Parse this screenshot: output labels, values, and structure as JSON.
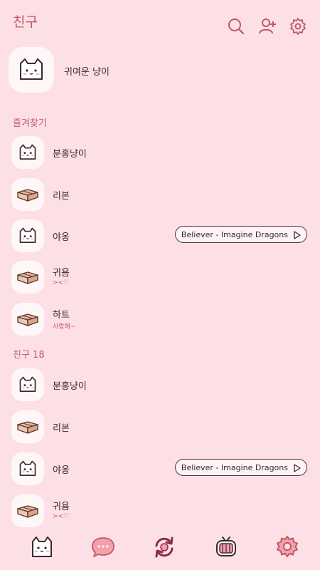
{
  "header": {
    "title": "친구"
  },
  "profile": {
    "name": "귀여운 냥이"
  },
  "favorites": {
    "section_label": "즐겨찾기",
    "items": [
      {
        "name": "분홍냥이",
        "avatar": "cat",
        "status": "",
        "music": ""
      },
      {
        "name": "리본",
        "avatar": "box",
        "status": "",
        "music": ""
      },
      {
        "name": "야옹",
        "avatar": "cat",
        "status": "",
        "music": "Believer - Imagine Dragons"
      },
      {
        "name": "귀욤",
        "avatar": "box",
        "status": "><♡",
        "music": ""
      },
      {
        "name": "하트",
        "avatar": "box",
        "status": "사랑해~",
        "music": ""
      }
    ]
  },
  "friends": {
    "section_label": "친구 18",
    "items": [
      {
        "name": "분홍냥이",
        "avatar": "cat",
        "status": "",
        "music": ""
      },
      {
        "name": "리본",
        "avatar": "box",
        "status": "",
        "music": ""
      },
      {
        "name": "야옹",
        "avatar": "cat",
        "status": "",
        "music": "Believer - Imagine Dragons"
      },
      {
        "name": "귀욤",
        "avatar": "box",
        "status": "><♡",
        "music": ""
      }
    ]
  },
  "icons": {
    "header": [
      "search-icon",
      "add-friend-icon",
      "settings-icon"
    ],
    "tabs": [
      "cat-friends-tab-icon",
      "chat-bubble-tab-icon",
      "refresh-tab-icon",
      "tv-tab-icon",
      "settings-tab-icon"
    ]
  },
  "colors": {
    "background": "#fde0e6",
    "accent": "#c0586a",
    "chat_bubble": "#f4a0ac"
  }
}
